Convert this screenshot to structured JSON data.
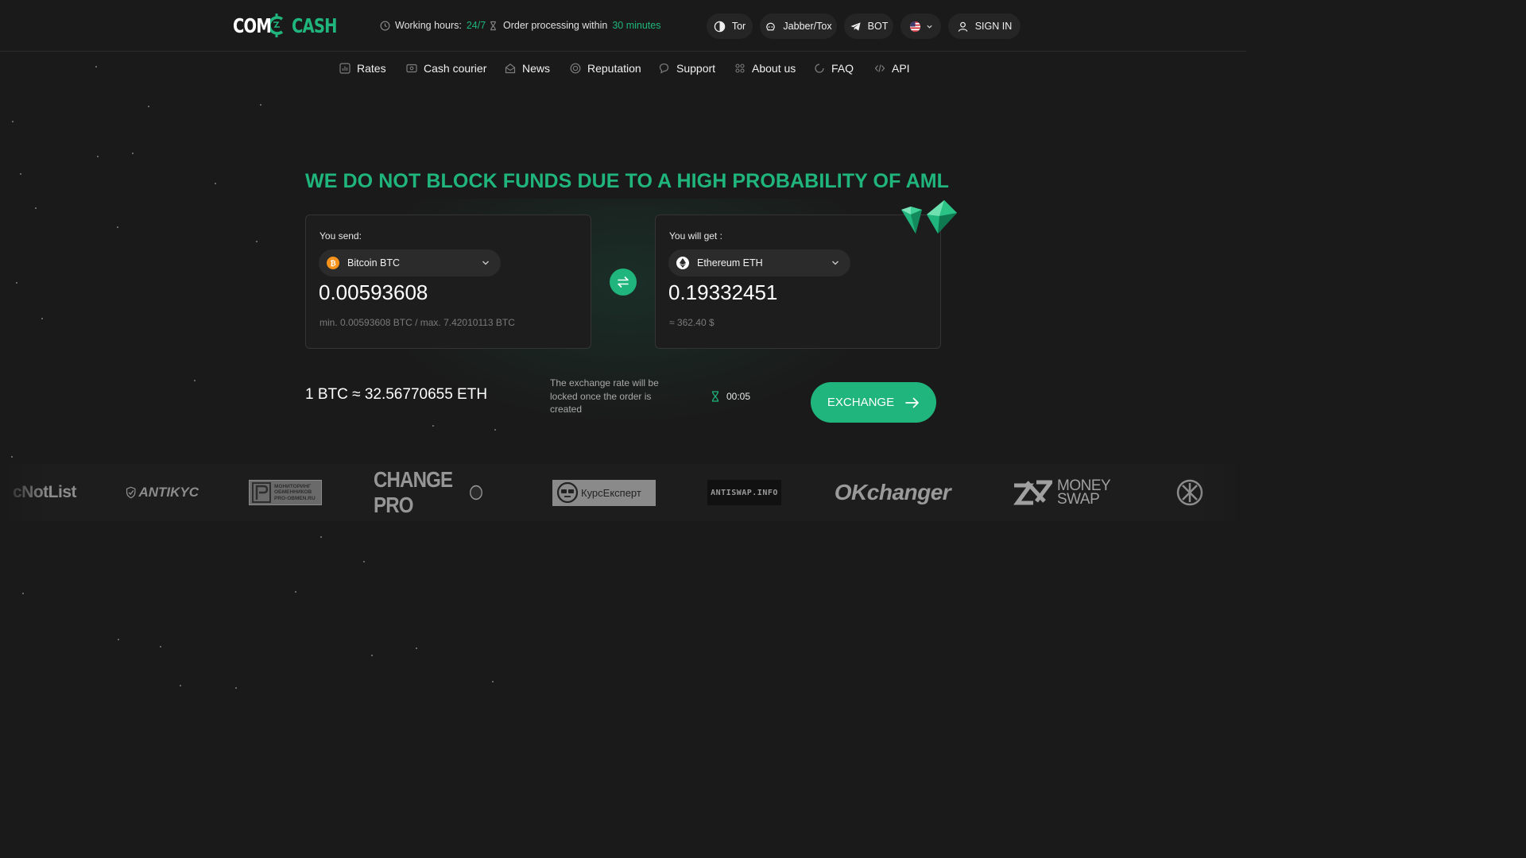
{
  "header": {
    "logo": {
      "left": "COM",
      "right": "CASH"
    },
    "working_hours": {
      "label": "Working hours:",
      "value": "24/7"
    },
    "order_processing": {
      "label": "Order processing within",
      "value": "30 minutes"
    },
    "buttons": {
      "tor": "Tor",
      "jabber": "Jabber/Tox",
      "bot": "BOT",
      "sign_in": "SIGN IN"
    },
    "language_icon": "us-flag-icon"
  },
  "nav": [
    {
      "label": "Rates",
      "icon": "chart-icon"
    },
    {
      "label": "Cash courier",
      "icon": "cash-icon"
    },
    {
      "label": "News",
      "icon": "news-icon"
    },
    {
      "label": "Reputation",
      "icon": "reputation-icon"
    },
    {
      "label": "Support",
      "icon": "support-icon"
    },
    {
      "label": "About us",
      "icon": "team-icon"
    },
    {
      "label": "FAQ",
      "icon": "faq-icon"
    },
    {
      "label": "API",
      "icon": "code-icon"
    }
  ],
  "headline": "WE DO NOT BLOCK FUNDS DUE TO A HIGH PROBABILITY OF AML",
  "send": {
    "label": "You send:",
    "currency": "Bitcoin BTC",
    "amount": "0.00593608",
    "limits": "min. 0.00593608 BTC / max. 7.42010113 BTC"
  },
  "receive": {
    "label": "You will get :",
    "currency": "Ethereum ETH",
    "amount": "0.19332451",
    "usd_estimate": "≈ 362.40 $"
  },
  "rate": "1 BTC ≈ 32.56770655 ETH",
  "lock_note": "The exchange rate will be locked once the order is created",
  "timer": "00:05",
  "exchange_button": "EXCHANGE",
  "partners": [
    "cNotList",
    "ANTIKYC",
    "МОНИТОРИНГ ОБМЕННИКОВ PRO-OBMEN.RU",
    "CHANGE PRO",
    "КурсЕксперт",
    "ANTISWAP.INFO",
    "OKchanger",
    "MONEY SWAP"
  ],
  "colors": {
    "accent": "#1fb57c",
    "background": "#1a1a1a",
    "card": "#1d1d1d",
    "pill": "#252525"
  }
}
